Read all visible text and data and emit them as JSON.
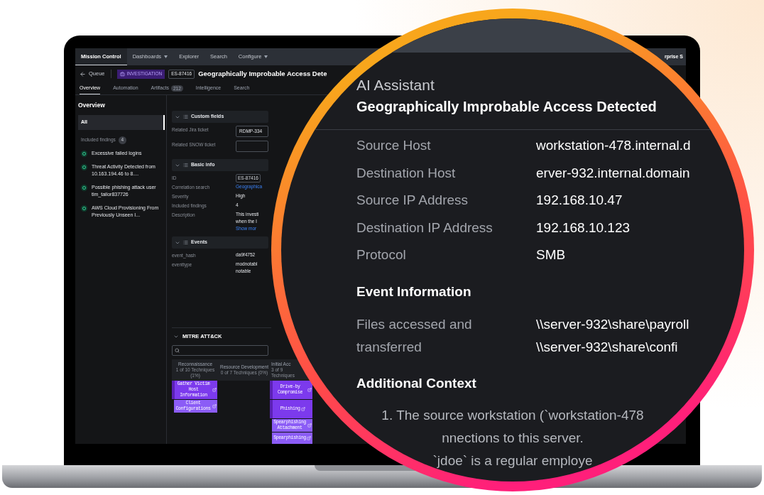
{
  "nav": {
    "items": [
      {
        "label": "Mission Control",
        "selected": true,
        "dropdown": false
      },
      {
        "label": "Dashboards",
        "selected": false,
        "dropdown": true
      },
      {
        "label": "Explorer",
        "selected": false,
        "dropdown": false
      },
      {
        "label": "Search",
        "selected": false,
        "dropdown": false
      },
      {
        "label": "Configure",
        "selected": false,
        "dropdown": true
      }
    ],
    "right_text": "rprise S"
  },
  "header": {
    "back_label": "Queue",
    "badge": "INVESTIGATION",
    "id": "ES-87416",
    "title": "Geographically Improbable Access Dete"
  },
  "tabs": [
    {
      "label": "Overview",
      "selected": true
    },
    {
      "label": "Automation",
      "selected": false
    },
    {
      "label": "Artifacts",
      "count": "212",
      "selected": false
    },
    {
      "label": "Intelligence",
      "selected": false
    },
    {
      "label": "Search",
      "selected": false
    }
  ],
  "sidebar": {
    "title": "Overview",
    "items": [
      {
        "label": "All",
        "selected": true
      }
    ],
    "findings_label": "Included findings",
    "findings_count": "4",
    "findings": [
      "Excessive failed logins",
      "Threat Activity Detected from 10.163.194.46 to 8....",
      "Possible phishing attack user tim_tailor837726",
      "AWS Cloud Provisioning From Previously Unseen I..."
    ]
  },
  "sections": [
    {
      "title": "Custom fields",
      "expanded": true,
      "rows": [
        {
          "label": "Related Jira ticket",
          "kind": "input",
          "value": "RDMP-334"
        },
        {
          "label": "Related SNOW ticket",
          "kind": "input"
        }
      ]
    },
    {
      "title": "Basic info",
      "expanded": true,
      "rows": [
        {
          "label": "ID",
          "kind": "pill",
          "value": "ES-87416"
        },
        {
          "label": "Correlation search",
          "kind": "link",
          "value": "Geographica"
        },
        {
          "label": "Severity",
          "kind": "text",
          "lines": [
            "High"
          ]
        },
        {
          "label": "Included findings",
          "kind": "text",
          "lines": [
            "4"
          ]
        },
        {
          "label": "Description",
          "kind": "text",
          "lines": [
            "This investi",
            "when the l"
          ],
          "link": "Show mor"
        }
      ]
    },
    {
      "title": "Events",
      "expanded": true,
      "rows": [
        {
          "label": "event_hash",
          "kind": "text",
          "lines": [
            "da9f4752"
          ]
        },
        {
          "label": "eventtype",
          "kind": "text",
          "lines": [
            "modnotabl",
            "notable"
          ]
        }
      ]
    }
  ],
  "mitre": {
    "title": "MITRE ATT&CK",
    "expanded": true,
    "columns": [
      {
        "name": "Reconnaissance",
        "summary": "1 of 10 Techniques (1%)",
        "techniques": [
          {
            "label": "Gather Victim Host Information",
            "has_subtechniques": true,
            "children": [
              {
                "label": "Client Configurations"
              }
            ]
          }
        ]
      },
      {
        "name": "Resource Development",
        "summary": "0 of 7 Techniques (0%)"
      },
      {
        "name": "Initial Acc",
        "summary": "3 of 9 Techniques",
        "techniques": [
          {
            "label": "Drive-by Compromise",
            "has_subtechniques": true
          },
          {
            "label": "Phishing",
            "has_subtechniques": true,
            "children": [
              {
                "label": "Spearphishing Attachment"
              },
              {
                "label": "Spearphishing"
              }
            ]
          }
        ]
      }
    ]
  },
  "assistant": {
    "title": "AI Assistant",
    "subtitle": "Geographically Improbable Access Detected",
    "fields": [
      {
        "label": "Source Host",
        "value": "workstation-478.internal.d"
      },
      {
        "label": "Destination Host",
        "value": "erver-932.internal.domain"
      },
      {
        "label": "Source IP Address",
        "value": "192.168.10.47"
      },
      {
        "label": "Destination IP Address",
        "value": "192.168.10.123"
      },
      {
        "label": "Protocol",
        "value": "SMB"
      }
    ],
    "event_heading": "Event Information",
    "event_fields": [
      {
        "label": "Files accessed and transferred",
        "values": [
          "\\\\server-932\\share\\payroll",
          "\\\\server-932\\share\\confi"
        ]
      }
    ],
    "context_heading": "Additional Context",
    "context_lines": [
      "1. The source workstation (`workstation-478",
      "nnections to this server.",
      "`jdoe` is a regular employe"
    ]
  }
}
